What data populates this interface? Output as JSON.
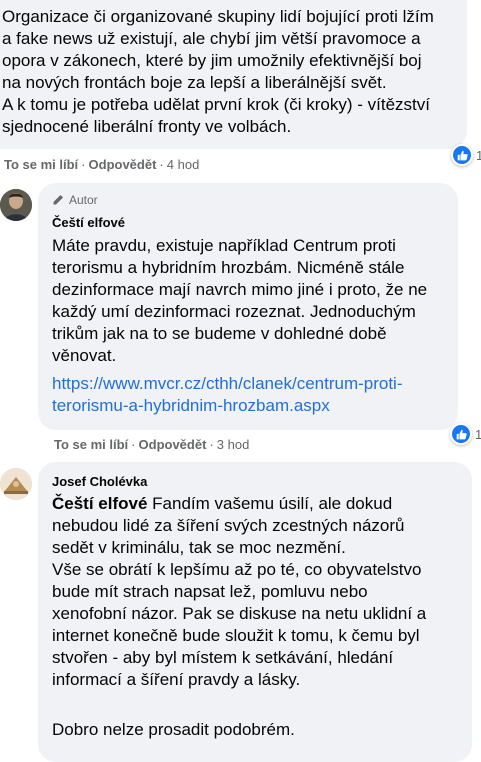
{
  "comment1": {
    "text": "Organizace či organizované skupiny lidí bojující proti lžím\na fake news už existují, ale chybí jim větší pravomoce a\nopora v zákonech, které by jim umožnily efektivnější boj\nna nových frontách boje za lepší a liberálnější svět.\nA k tomu je potřeba udělat první krok (či kroky) - vítězství\nsjednocené liberální fronty ve volbách.",
    "like": "To se mi líbí",
    "reply": "Odpovědět",
    "time": "4 hod",
    "reaction_count": "1"
  },
  "comment2": {
    "author_badge": "Autor",
    "author": "Čeští elfové",
    "text": "Máte pravdu, existuje například Centrum proti\nterorismu a hybridním hrozbám. Nicméně stále\ndezinformace mají navrch mimo jiné i proto, že ne\nkaždý umí dezinformaci rozeznat. Jednoduchým\ntrikům jak na to se budeme v dohledné době\nvěnovat.",
    "link": "https://www.mvcr.cz/cthh/clanek/centrum-proti-\nterorismu-a-hybridnim-hrozbam.aspx",
    "like": "To se mi líbí",
    "reply": "Odpovědět",
    "time": "3 hod",
    "reaction_count": "1"
  },
  "comment3": {
    "author": "Josef Cholévka",
    "mention": "Čeští elfové",
    "text": " Fandím vašemu úsilí, ale dokud\nnebudou lidé za šíření svých zcestných názorů\nsedět v kriminálu, tak se moc nezmění.\nVše se obrátí k lepšímu až po té, co obyvatelstvo\nbude mít strach napsat lež, pomluvu nebo\nxenofobní názor. Pak se diskuse na netu uklidní a\ninternet konečně bude sloužit k tomu, k čemu byl\nstvořen - aby byl místem k setkávání, hledání\ninformací a šíření pravdy a lásky.",
    "closing": "Dobro nelze prosadit podobrém."
  },
  "icons": {
    "like": "thumbs-up-icon",
    "author_badge": "pencil-icon"
  },
  "colors": {
    "bubble": "#f0f2f5",
    "link": "#216fdb",
    "meta": "#65676b",
    "like_blue": "#1877f2"
  }
}
